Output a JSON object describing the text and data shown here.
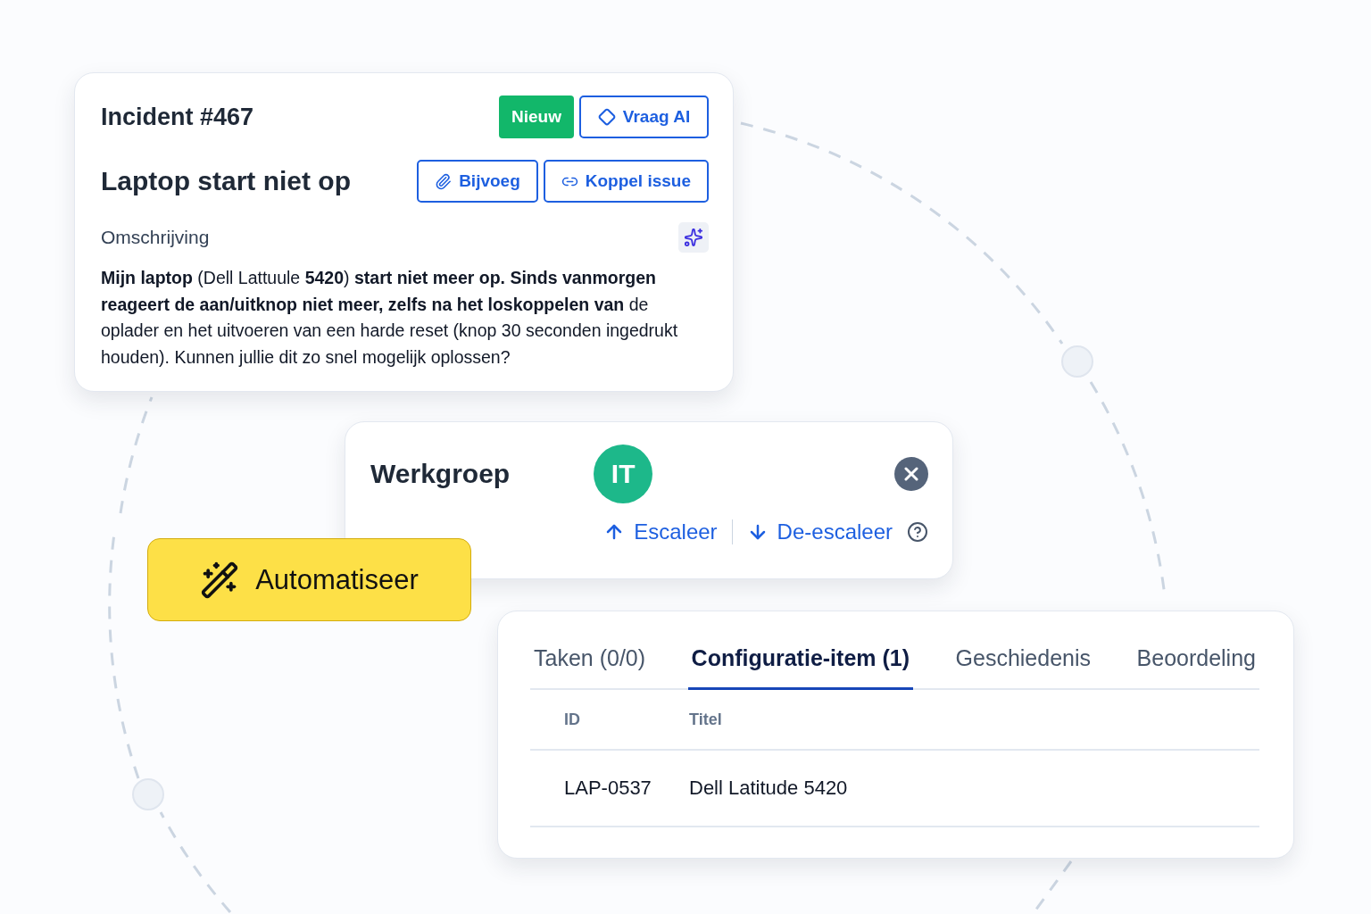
{
  "incident": {
    "title": "Incident #467",
    "status": "Nieuw",
    "ask_ai": "Vraag AI",
    "subject": "Laptop start niet op",
    "actions": [
      "Bijvoeg",
      "Koppel issue"
    ],
    "description_label": "Omschrijving",
    "description": "**Mijn laptop** (Dell Lattuule **5420**) **start niet meer op. Sinds vanmorgen reageert de aan/uitknop niet meer, zelfs na het loskoppelen van** de oplader en het uitvoeren van een harde reset (knop 30 seconden ingedrukt houden). Kunnen jullie dit zo snel mogelijk oplossen?"
  },
  "workgroup": {
    "label": "Werkgroep",
    "avatar": "IT",
    "escalate": "Escaleer",
    "deescalate": "De-escaleer"
  },
  "automate": {
    "label": "Automatiseer"
  },
  "details": {
    "tabs": [
      {
        "label": "Taken (0/0)",
        "selected": false
      },
      {
        "label": "Configuratie-item (1)",
        "selected": true
      },
      {
        "label": "Geschiedenis",
        "selected": false
      },
      {
        "label": "Beoordeling",
        "selected": false
      }
    ],
    "table": {
      "columns": [
        "ID",
        "Titel"
      ],
      "rows": [
        [
          "LAP-0537",
          "Dell Latitude 5420"
        ]
      ]
    }
  }
}
